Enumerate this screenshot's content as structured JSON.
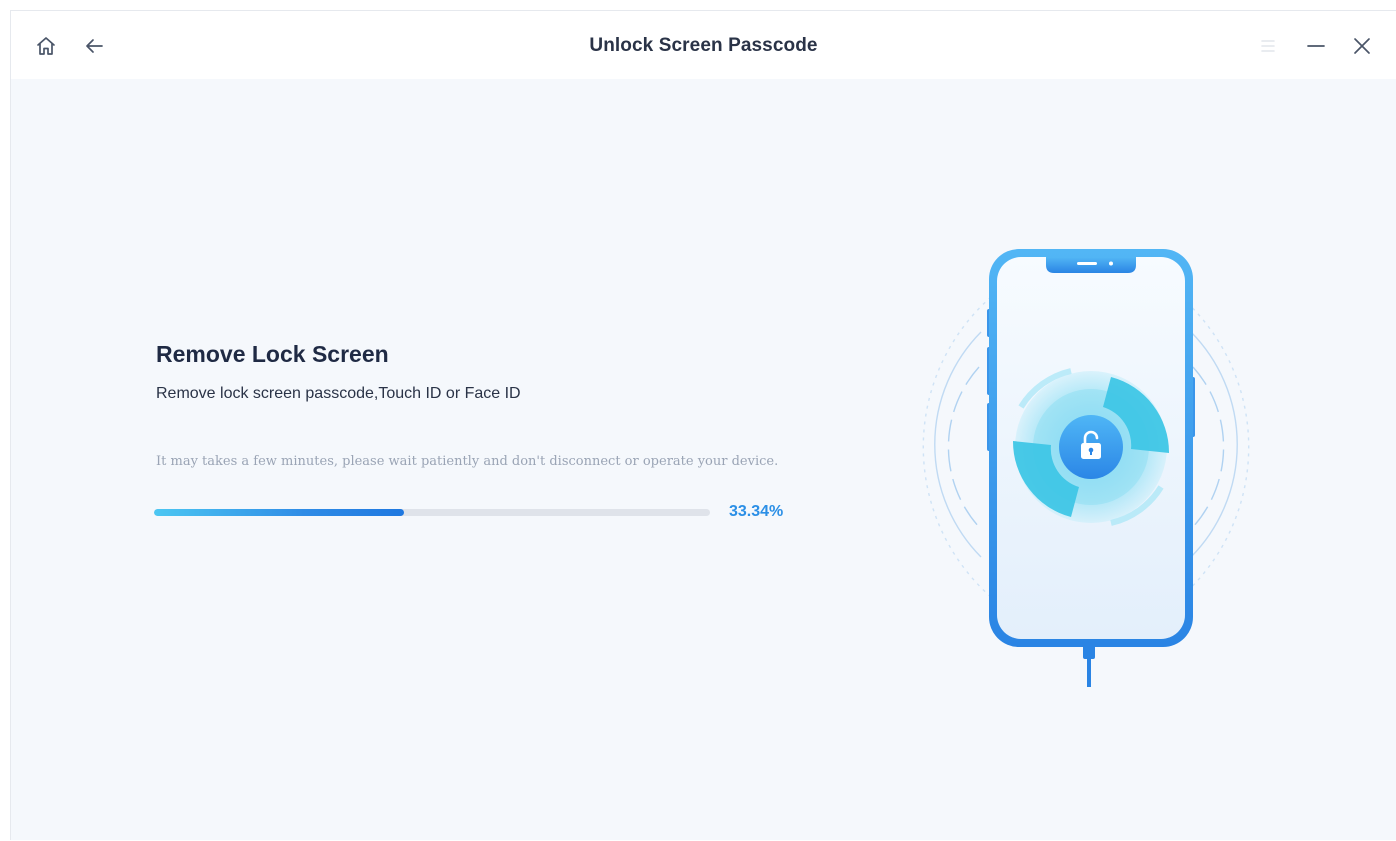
{
  "titlebar": {
    "title": "Unlock Screen Passcode",
    "icons": [
      "home-icon",
      "back-arrow-icon",
      "menu-icon",
      "minimize-icon",
      "close-icon"
    ]
  },
  "main": {
    "heading": "Remove Lock Screen",
    "subheading": "Remove lock screen passcode,Touch ID or Face ID",
    "hint": "It may takes a few minutes, please wait patiently and don't disconnect or operate your device.",
    "progress": {
      "value": 33.34,
      "label": "33.34%"
    }
  },
  "illustration": {
    "icons": [
      "phone-icon",
      "lock-icon",
      "usb-cable-icon"
    ]
  },
  "colors": {
    "accent": "#2b8fe6",
    "background": "#f5f8fc",
    "heading": "#1f2a44"
  }
}
